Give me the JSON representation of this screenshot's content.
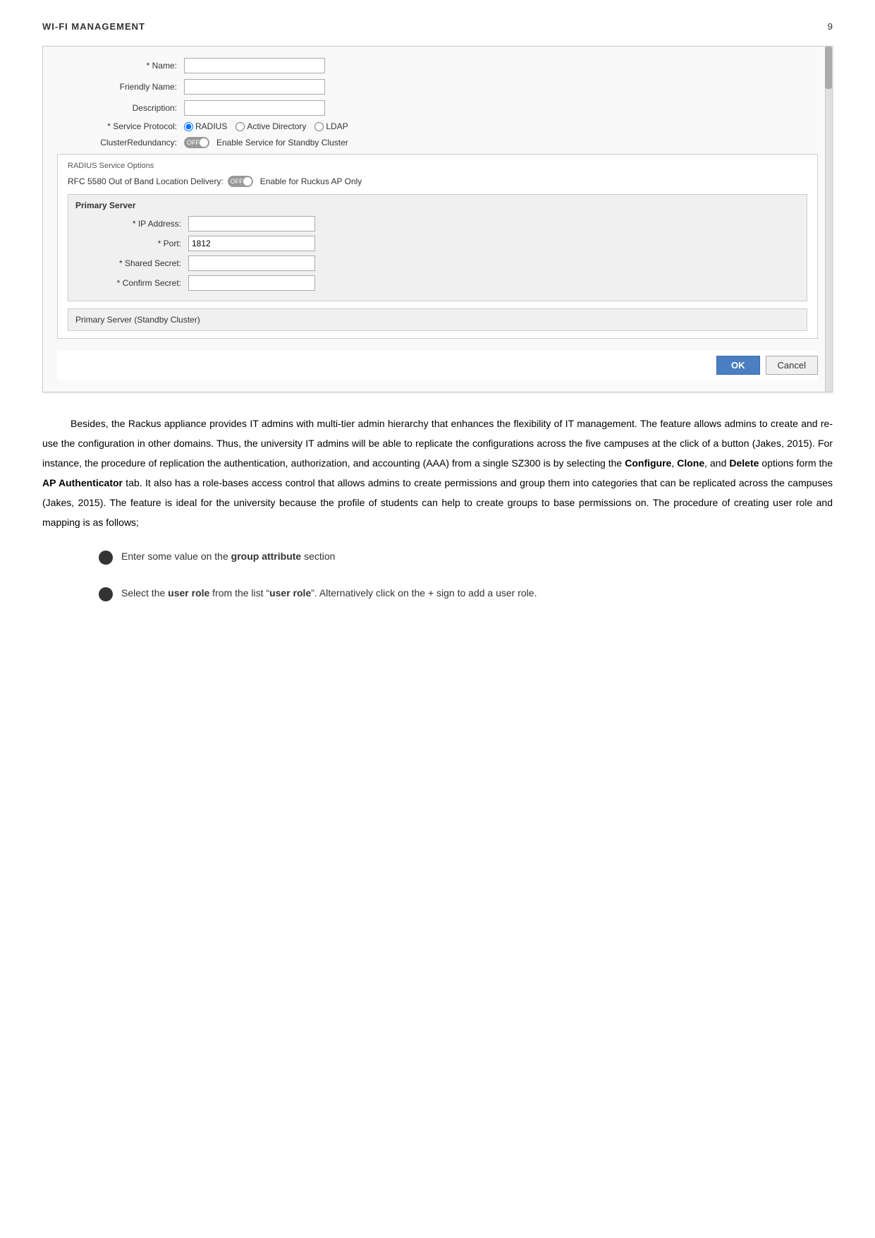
{
  "header": {
    "title": "WI-FI MANAGEMENT",
    "page_number": "9"
  },
  "dialog": {
    "fields": {
      "name_label": "* Name:",
      "friendly_name_label": "Friendly Name:",
      "description_label": "Description:",
      "service_protocol_label": "* Service Protocol:",
      "cluster_redundancy_label": "ClusterRedundancy:",
      "cluster_toggle_text": "OFF",
      "cluster_toggle_description": "Enable Service for Standby Cluster"
    },
    "service_protocols": [
      "RADIUS",
      "Active Directory",
      "LDAP"
    ],
    "selected_protocol": "RADIUS",
    "radius_section": {
      "title": "RADIUS Service Options",
      "rfc_label": "RFC 5580 Out of Band Location Delivery:",
      "rfc_toggle_text": "OFF",
      "rfc_toggle_description": "Enable for Ruckus AP Only"
    },
    "primary_server": {
      "title": "Primary Server",
      "ip_address_label": "* IP Address:",
      "port_label": "* Port:",
      "port_value": "1812",
      "shared_secret_label": "* Shared Secret:",
      "confirm_secret_label": "* Confirm Secret:"
    },
    "standby": {
      "title": "Primary Server (Standby Cluster)"
    },
    "buttons": {
      "ok": "OK",
      "cancel": "Cancel"
    }
  },
  "body_text": {
    "paragraph1": "Besides, the Rackus appliance provides IT admins with multi-tier admin hierarchy that enhances the flexibility of IT management. The feature allows admins to create and re-use the configuration in other domains. Thus, the university IT admins will be able to replicate the configurations across the five campuses at the click of a button (Jakes, 2015). For instance, the procedure of replication the authentication, authorization, and accounting (AAA) from a single SZ300 is by selecting the Configure, Clone, and Delete options form the AP Authenticator tab. It also has a role-bases access control that allows admins to create permissions and group them into categories that can be replicated across the campuses (Jakes, 2015). The feature is ideal for the university because the profile of students can help to create groups to base permissions on. The procedure of creating user role and mapping is as follows;"
  },
  "bullet_items": [
    {
      "text_before": "Enter some value on the ",
      "text_bold": "group attribute",
      "text_after": " section"
    },
    {
      "text_before": "Select the ",
      "text_bold_1": "user role",
      "text_middle": " from the list “",
      "text_bold_2": "user role",
      "text_after": "”. Alternatively click on the + sign to add a user role."
    }
  ]
}
